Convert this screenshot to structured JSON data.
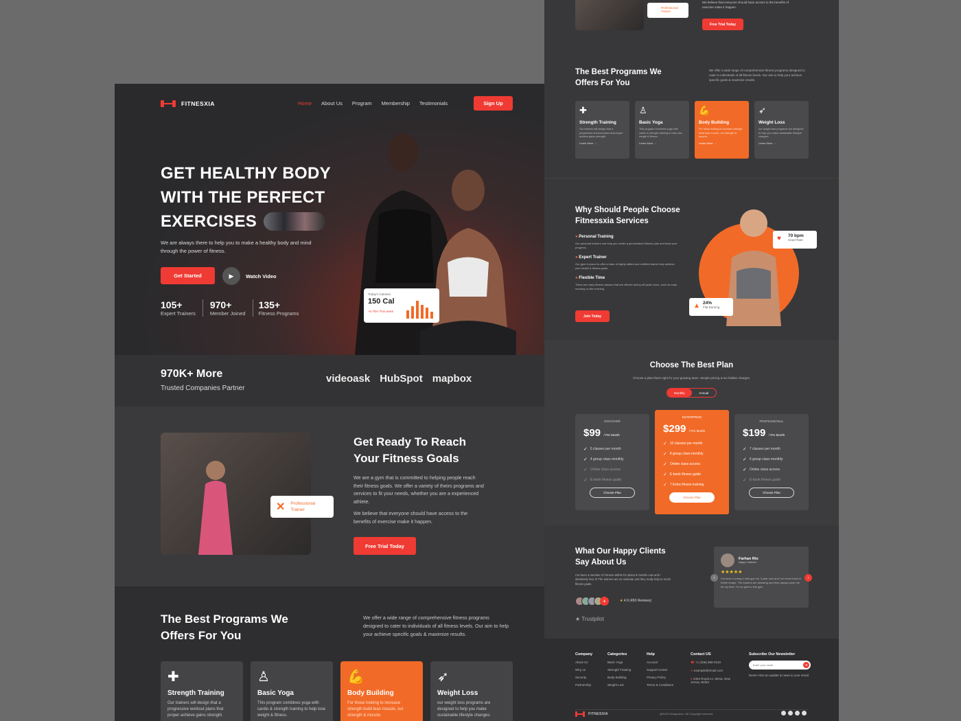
{
  "brand": {
    "name": "FITNESXIA"
  },
  "nav": {
    "items": [
      "Home",
      "About Us",
      "Program",
      "Membership",
      "Testimonials"
    ],
    "signup": "Sign Up"
  },
  "hero": {
    "line1": "GET HEALTHY BODY",
    "line2": "WITH THE PERFECT",
    "line3": "EXERCISES",
    "subtitle": "We are always there to help you to make a healthy body and mind through the power of fitness.",
    "get_started": "Get Started",
    "watch_video": "Watch Video",
    "stats": [
      {
        "value": "105+",
        "label": "Expert Trainers"
      },
      {
        "value": "970+",
        "label": "Member Joined"
      },
      {
        "value": "135+",
        "label": "Fitness Programs"
      }
    ],
    "calories": {
      "title": "Today's Calories",
      "value": "150 Cal",
      "delta": "+0.75% This week"
    }
  },
  "partners": {
    "count": "970K+ More",
    "label": "Trusted Companies Partner",
    "logos": [
      "videoask",
      "HubSpot",
      "mapbox"
    ]
  },
  "ready": {
    "title1": "Get Ready To Reach",
    "title2": "Your Fitness Goals",
    "p1": "We are a gym that is committed to helping people reach their fitness goals. We offer a variety of theirs programs and services to fit your needs, whether you are a experienced athlete.",
    "p2": "We believe that everyone should have access to the benefits of exercise make it happen.",
    "cta": "Free Trial Today",
    "badge": "Professional Trainer"
  },
  "programs": {
    "title1": "The Best Programs We",
    "title2": "Offers For You",
    "desc": "We offer a wide range of comprehensive fitness programs designed to cater to individuals of all fitness levels. Our aim to help your achieve specific goals & maximize results.",
    "learn": "Learn More →",
    "items": [
      {
        "name": "Strength Training",
        "text": "Our trainers will design that a progressive workout plans that proper achieve gains strength."
      },
      {
        "name": "Basic Yoga",
        "text": "This program combines yoga with cardio & strength training to help lose weight & fitness."
      },
      {
        "name": "Body Building",
        "text": "For those looking to increase strength build lean muscle, our strength & muscle."
      },
      {
        "name": "Weight Loss",
        "text": "our weight loss programs are designed to help you make sustainable lifestyle changes."
      }
    ]
  },
  "why": {
    "title1": "Why Should People Choose",
    "title2": "Fitnessxia Services",
    "items": [
      {
        "name": "Personal Training",
        "text": "Our personal trainers can help you create a personalized fitness plan and track your progress."
      },
      {
        "name": "Expert Trainer",
        "text": "Our gym is proud to offer a team of highly skilled and certified trainer help achieve your health & fitness goals."
      },
      {
        "name": "Flexible Time",
        "text": "There are many fitness classes that are offered during off-peak hours, such as early morning or late evening."
      }
    ],
    "cta": "Join Today",
    "heart": {
      "value": "70 bpm",
      "label": "Heart Rate"
    },
    "fat": {
      "value": "24%",
      "label": "Flat Burning"
    }
  },
  "plans": {
    "title": "Choose The Best Plan",
    "subtitle": "Choose a plan that's right for your growing team. Simple pricing & No hidden charges.",
    "toggle": [
      "Monthly",
      "Annual"
    ],
    "per": "/ Per Month",
    "choose": "Choose Plan",
    "tiers": [
      {
        "name": "DISCOVER",
        "price": "$99",
        "features": [
          "5 classes per month",
          "4 group class monthly",
          "Online class access",
          "E-book fitness guide"
        ]
      },
      {
        "name": "ENTERPRISE",
        "price": "$299",
        "features": [
          "10 classes per month",
          "8 group class monthly",
          "Online class access",
          "E-book fitness guide",
          "7 Extra fitness training"
        ]
      },
      {
        "name": "PROFESSIONAL",
        "price": "$199",
        "features": [
          "7 classes per month",
          "6 group class monthly",
          "Online class access",
          "E-book fitness guide"
        ]
      }
    ]
  },
  "testimonials": {
    "title1": "What Our Happy Clients",
    "title2": "Say About Us",
    "text": "I've been a member of Fitness Within for about 6 months now and I absolutely love it! The trainers are so motivate and they really help to reach fitness goals.",
    "rating": "4.9 (450 Reviews)",
    "trustpilot": "Trustpilot",
    "review": {
      "name": "Farhan Rio",
      "role": "Happy Customer",
      "stars": "★★★★★",
      "text": "I've been coming to this gym for 3 year now and I've never been in better shape. The trainers are amazing and they always push me be my best. I'm so glad to this gym"
    }
  },
  "footer": {
    "cols": [
      {
        "title": "Company",
        "links": [
          "About Us",
          "Why us",
          "Security",
          "Partnership"
        ]
      },
      {
        "title": "Categories",
        "links": [
          "Basic Yoga",
          "Strength Training",
          "Body Building",
          "Weight Lost"
        ]
      },
      {
        "title": "Help",
        "links": [
          "Account",
          "Support Center",
          "Privacy Policy",
          "Terms & Conditions"
        ]
      }
    ],
    "contact": {
      "title": "Contact US",
      "phone": "+1 (406) 555-0120",
      "email": "example@email.com",
      "address": "2464 Royal Ln. Mesa, New Jersey 45463"
    },
    "newsletter": {
      "title": "Subscribe Our Newsletter",
      "placeholder": "Enter your email",
      "note": "Never miss an update & news to your email."
    },
    "copyright": "@2023 DesignAven. All Copyright reserved."
  },
  "colors": {
    "accent": "#ef3b33",
    "orange": "#f26a27",
    "bg": "#2e2e30"
  }
}
